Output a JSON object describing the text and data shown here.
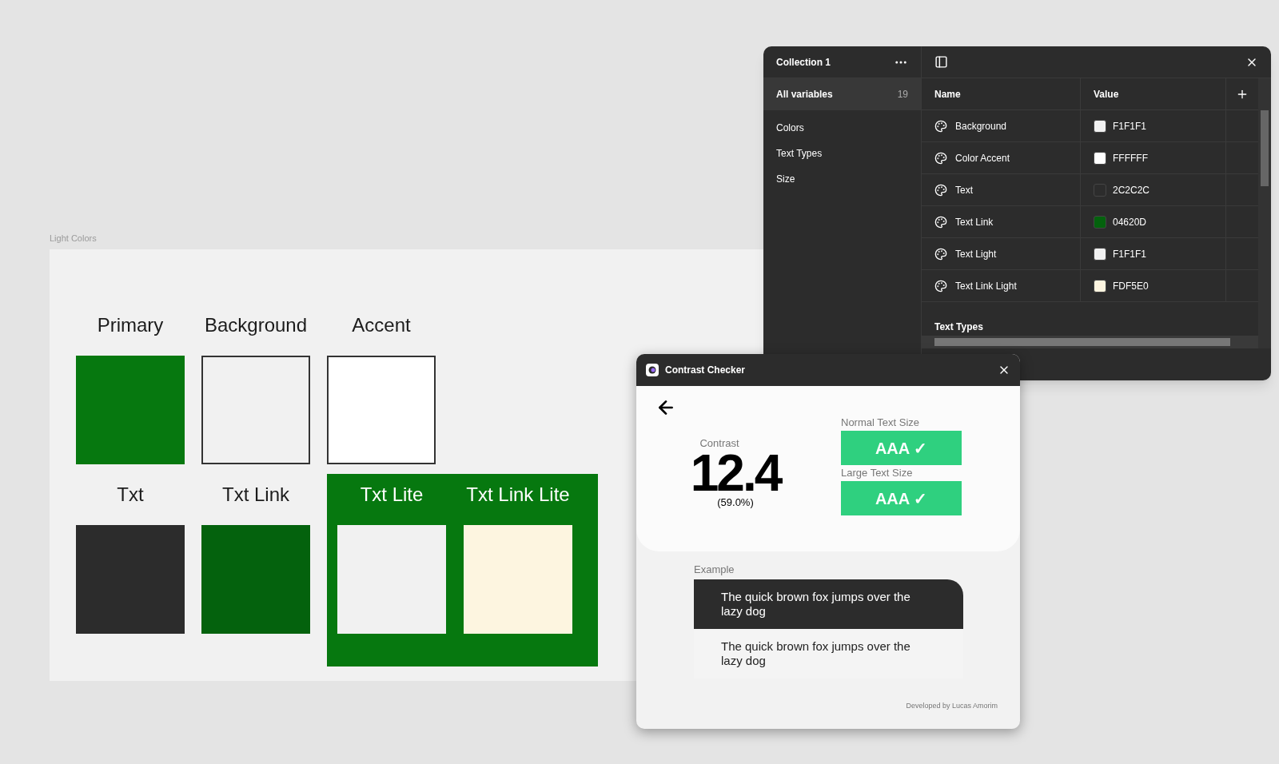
{
  "frame": {
    "label": "Light Colors",
    "top_row": [
      {
        "label": "Primary",
        "color": "#06780f",
        "bordered": false
      },
      {
        "label": "Background",
        "color": "#f1f1f1",
        "bordered": true
      },
      {
        "label": "Accent",
        "color": "#ffffff",
        "bordered": true
      }
    ],
    "bottom_row": [
      {
        "label": "Txt",
        "color": "#2c2c2c"
      },
      {
        "label": "Txt Link",
        "color": "#04620d"
      }
    ],
    "on_primary_group": {
      "color": "#06780f",
      "swatches": [
        {
          "label": "Txt Lite",
          "color": "#f1f1f1"
        },
        {
          "label": "Txt Link Lite",
          "color": "#fdf5e0"
        }
      ]
    }
  },
  "variables_panel": {
    "title": "Collection 1",
    "sidebar": [
      {
        "label": "All variables",
        "count": "19",
        "selected": true
      },
      {
        "label": "Colors",
        "selected": false
      },
      {
        "label": "Text Types",
        "selected": false
      },
      {
        "label": "Size",
        "selected": false
      }
    ],
    "columns": [
      "Name",
      "Value"
    ],
    "rows": [
      {
        "name": "Background",
        "value": "F1F1F1",
        "color": "#f1f1f1"
      },
      {
        "name": "Color Accent",
        "value": "FFFFFF",
        "color": "#ffffff"
      },
      {
        "name": "Text",
        "value": "2C2C2C",
        "color": "#2c2c2c"
      },
      {
        "name": "Text Link",
        "value": "04620D",
        "color": "#04620d"
      },
      {
        "name": "Text Light",
        "value": "F1F1F1",
        "color": "#f1f1f1"
      },
      {
        "name": "Text Link Light",
        "value": "FDF5E0",
        "color": "#fdf5e0"
      }
    ],
    "section_heading": "Text Types"
  },
  "contrast_checker": {
    "title": "Contrast Checker",
    "contrast_label": "Contrast",
    "ratio": "12.4",
    "percent": "(59.0%)",
    "results": [
      {
        "label": "Normal Text Size",
        "grade": "AAA ✓",
        "passed": true
      },
      {
        "label": "Large Text Size",
        "grade": "AAA ✓",
        "passed": true
      }
    ],
    "example_label": "Example",
    "examples": [
      {
        "text": "The quick brown fox jumps over the lazy dog",
        "kind": "dark"
      },
      {
        "text": "The quick brown fox jumps over the lazy dog",
        "kind": "light"
      }
    ],
    "footer": "Developed by Lucas Amorim"
  }
}
